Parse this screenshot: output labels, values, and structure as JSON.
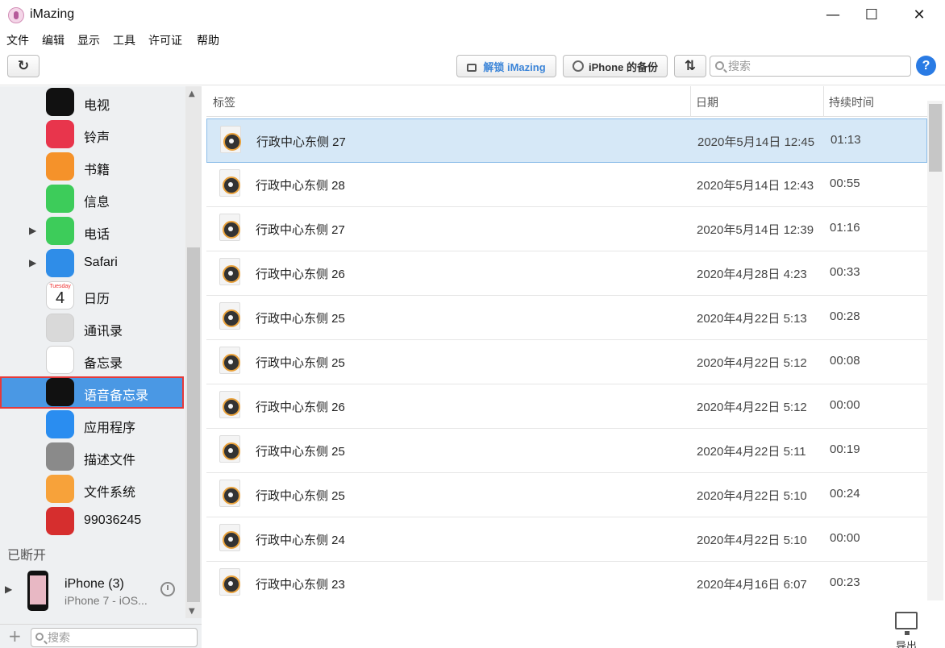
{
  "window": {
    "title": "iMazing",
    "minimize_glyph": "—",
    "maximize_glyph": "☐",
    "close_glyph": "✕"
  },
  "menu": [
    "文件",
    "编辑",
    "显示",
    "工具",
    "许可证",
    "帮助"
  ],
  "toolbar": {
    "unlock_label": "解锁 iMazing",
    "backup_label": "iPhone 的备份",
    "search_placeholder": "搜索",
    "help_label": "?",
    "refresh_glyph": "↻",
    "transfer_glyph": "⇅"
  },
  "sidebar": {
    "items": [
      {
        "label": "电视",
        "icon": "tv-app-icon",
        "color": "#111111"
      },
      {
        "label": "铃声",
        "icon": "ringtones-icon",
        "color": "#e8354c"
      },
      {
        "label": "书籍",
        "icon": "books-icon",
        "color": "#f5922a"
      },
      {
        "label": "信息",
        "icon": "messages-icon",
        "color": "#3dcc5a"
      },
      {
        "label": "电话",
        "icon": "phone-icon",
        "color": "#3dcc5a",
        "expandable": true
      },
      {
        "label": "Safari",
        "icon": "safari-icon",
        "color": "#2f8de8",
        "expandable": true
      },
      {
        "label": "日历",
        "icon": "calendar-icon",
        "color": "#ffffff",
        "calendar_day": "Tuesday",
        "calendar_date": "4"
      },
      {
        "label": "通讯录",
        "icon": "contacts-icon",
        "color": "#d9d9d9"
      },
      {
        "label": "备忘录",
        "icon": "notes-icon",
        "color": "#ffffff"
      },
      {
        "label": "语音备忘录",
        "icon": "voice-memos-icon",
        "color": "#111111",
        "selected": true
      },
      {
        "label": "应用程序",
        "icon": "app-store-icon",
        "color": "#2a8df0"
      },
      {
        "label": "描述文件",
        "icon": "settings-icon",
        "color": "#8a8a8a"
      },
      {
        "label": "文件系统",
        "icon": "file-system-icon",
        "color": "#f7a23a"
      },
      {
        "label": "99036245",
        "icon": "app-red-icon",
        "color": "#d62e2e"
      }
    ],
    "disconnected_label": "已断开",
    "device": {
      "name": "iPhone (3)",
      "model": "iPhone 7 - iOS..."
    },
    "add_glyph": "+",
    "search_placeholder": "搜索"
  },
  "table": {
    "columns": [
      "标签",
      "日期",
      "持续时间"
    ],
    "rows": [
      {
        "label": "行政中心东侧 27",
        "date": "2020年5月14日 12:45",
        "duration": "01:13",
        "selected": true
      },
      {
        "label": "行政中心东侧 28",
        "date": "2020年5月14日 12:43",
        "duration": "00:55"
      },
      {
        "label": "行政中心东侧 27",
        "date": "2020年5月14日 12:39",
        "duration": "01:16"
      },
      {
        "label": "行政中心东侧 26",
        "date": "2020年4月28日 4:23",
        "duration": "00:33"
      },
      {
        "label": "行政中心东侧 25",
        "date": "2020年4月22日 5:13",
        "duration": "00:28"
      },
      {
        "label": "行政中心东侧 25",
        "date": "2020年4月22日 5:12",
        "duration": "00:08"
      },
      {
        "label": "行政中心东侧 26",
        "date": "2020年4月22日 5:12",
        "duration": "00:00"
      },
      {
        "label": "行政中心东侧 25",
        "date": "2020年4月22日 5:11",
        "duration": "00:19"
      },
      {
        "label": "行政中心东侧 25",
        "date": "2020年4月22日 5:10",
        "duration": "00:24"
      },
      {
        "label": "行政中心东侧 24",
        "date": "2020年4月22日 5:10",
        "duration": "00:00"
      },
      {
        "label": "行政中心东侧 23",
        "date": "2020年4月16日 6:07",
        "duration": "00:23"
      }
    ]
  },
  "footer": {
    "export_label": "导出"
  },
  "colors": {
    "accent": "#4a98e4",
    "selected_row": "#d6e8f7",
    "highlight_border": "#e53a3a",
    "help": "#2a7be4"
  }
}
